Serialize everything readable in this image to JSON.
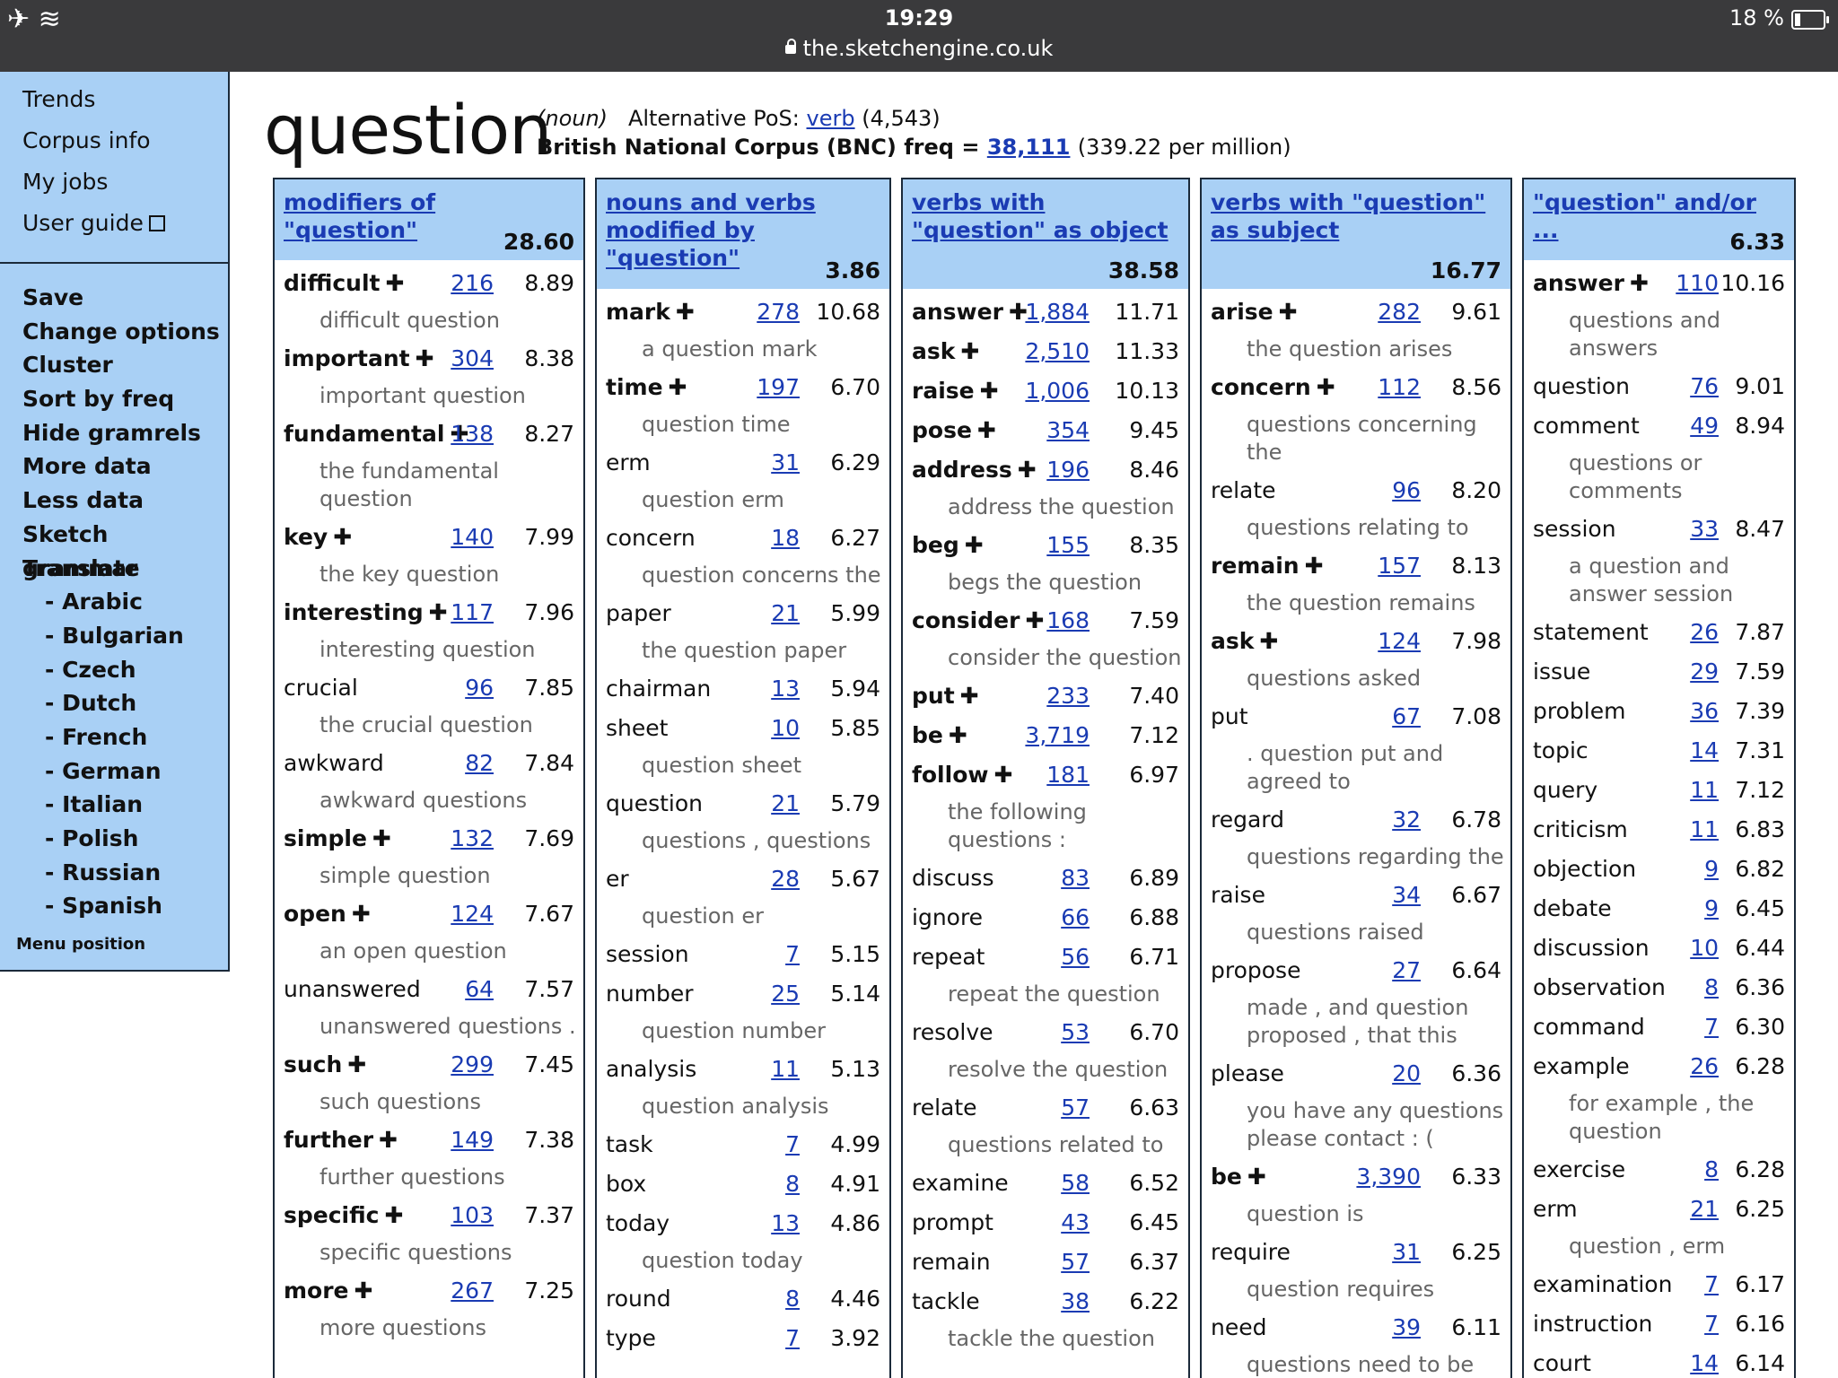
{
  "statusbar": {
    "time": "19:29",
    "url": "the.sketchengine.co.uk",
    "battery": "18 %"
  },
  "sidebar": {
    "top_links": [
      "Trends",
      "Corpus info",
      "My jobs",
      "User guide"
    ],
    "menu": [
      "Save",
      "Change options",
      "Cluster",
      "Sort by freq",
      "Hide gramrels",
      "More data",
      "Less data",
      "Sketch grammar",
      "Translate"
    ],
    "languages": [
      "- Arabic",
      "- Bulgarian",
      "- Czech",
      "- Dutch",
      "- French",
      "- German",
      "- Italian",
      "- Polish",
      "- Russian",
      "- Spanish"
    ],
    "menu_position": "Menu position"
  },
  "header": {
    "word": "question",
    "pos": "(noun)",
    "alt_pos_label": "Alternative PoS:",
    "alt_pos_link": "verb",
    "alt_pos_count": "(4,543)",
    "corpus_label": "British National Corpus (BNC) freq =",
    "freq_link": "38,111",
    "per_million": "(339.22 per million)"
  },
  "columns": [
    {
      "title": "modifiers of \"question\"",
      "score": "28.60",
      "rows": [
        [
          "difficult",
          1,
          "216",
          "8.89",
          "difficult question"
        ],
        [
          "important",
          1,
          "304",
          "8.38",
          "important question"
        ],
        [
          "fundamental",
          1,
          "138",
          "8.27",
          "the fundamental question"
        ],
        [
          "key",
          1,
          "140",
          "7.99",
          "the key question"
        ],
        [
          "interesting",
          1,
          "117",
          "7.96",
          "interesting question"
        ],
        [
          "crucial",
          0,
          "96",
          "7.85",
          "the crucial question"
        ],
        [
          "awkward",
          0,
          "82",
          "7.84",
          "awkward questions"
        ],
        [
          "simple",
          1,
          "132",
          "7.69",
          "simple question"
        ],
        [
          "open",
          1,
          "124",
          "7.67",
          "an open question"
        ],
        [
          "unanswered",
          0,
          "64",
          "7.57",
          "unanswered questions ."
        ],
        [
          "such",
          1,
          "299",
          "7.45",
          "such questions"
        ],
        [
          "further",
          1,
          "149",
          "7.38",
          "further questions"
        ],
        [
          "specific",
          1,
          "103",
          "7.37",
          "specific questions"
        ],
        [
          "more",
          1,
          "267",
          "7.25",
          "more questions"
        ]
      ]
    },
    {
      "title": "nouns and verbs modified by \"question\"",
      "score": "3.86",
      "rows": [
        [
          "mark",
          1,
          "278",
          "10.68",
          "a question mark"
        ],
        [
          "time",
          1,
          "197",
          "6.70",
          "question time"
        ],
        [
          "erm",
          0,
          "31",
          "6.29",
          "question erm"
        ],
        [
          "concern",
          0,
          "18",
          "6.27",
          "question concerns the"
        ],
        [
          "paper",
          0,
          "21",
          "5.99",
          "the question paper"
        ],
        [
          "chairman",
          0,
          "13",
          "5.94",
          ""
        ],
        [
          "sheet",
          0,
          "10",
          "5.85",
          "question sheet"
        ],
        [
          "question",
          0,
          "21",
          "5.79",
          "questions , questions"
        ],
        [
          "er",
          0,
          "28",
          "5.67",
          "question er"
        ],
        [
          "session",
          0,
          "7",
          "5.15",
          ""
        ],
        [
          "number",
          0,
          "25",
          "5.14",
          "question number"
        ],
        [
          "analysis",
          0,
          "11",
          "5.13",
          "question analysis"
        ],
        [
          "task",
          0,
          "7",
          "4.99",
          ""
        ],
        [
          "box",
          0,
          "8",
          "4.91",
          ""
        ],
        [
          "today",
          0,
          "13",
          "4.86",
          "question today"
        ],
        [
          "round",
          0,
          "8",
          "4.46",
          ""
        ],
        [
          "type",
          0,
          "7",
          "3.92",
          ""
        ]
      ]
    },
    {
      "title": "verbs with \"question\" as object",
      "score": "38.58",
      "rows": [
        [
          "answer",
          1,
          "1,884",
          "11.71",
          ""
        ],
        [
          "ask",
          1,
          "2,510",
          "11.33",
          ""
        ],
        [
          "raise",
          1,
          "1,006",
          "10.13",
          ""
        ],
        [
          "pose",
          1,
          "354",
          "9.45",
          ""
        ],
        [
          "address",
          1,
          "196",
          "8.46",
          "address the question"
        ],
        [
          "beg",
          1,
          "155",
          "8.35",
          "begs the question"
        ],
        [
          "consider",
          1,
          "168",
          "7.59",
          "consider the question"
        ],
        [
          "put",
          1,
          "233",
          "7.40",
          ""
        ],
        [
          "be",
          1,
          "3,719",
          "7.12",
          ""
        ],
        [
          "follow",
          1,
          "181",
          "6.97",
          "the following questions :"
        ],
        [
          "discuss",
          0,
          "83",
          "6.89",
          ""
        ],
        [
          "ignore",
          0,
          "66",
          "6.88",
          ""
        ],
        [
          "repeat",
          0,
          "56",
          "6.71",
          "repeat the question"
        ],
        [
          "resolve",
          0,
          "53",
          "6.70",
          "resolve the question"
        ],
        [
          "relate",
          0,
          "57",
          "6.63",
          "questions related to"
        ],
        [
          "examine",
          0,
          "58",
          "6.52",
          ""
        ],
        [
          "prompt",
          0,
          "43",
          "6.45",
          ""
        ],
        [
          "remain",
          0,
          "57",
          "6.37",
          ""
        ],
        [
          "tackle",
          0,
          "38",
          "6.22",
          "tackle the question"
        ]
      ]
    },
    {
      "title": "verbs with \"question\" as subject",
      "score": "16.77",
      "rows": [
        [
          "arise",
          1,
          "282",
          "9.61",
          "the question arises"
        ],
        [
          "concern",
          1,
          "112",
          "8.56",
          "questions concerning the"
        ],
        [
          "relate",
          0,
          "96",
          "8.20",
          "questions relating to"
        ],
        [
          "remain",
          1,
          "157",
          "8.13",
          "the question remains"
        ],
        [
          "ask",
          1,
          "124",
          "7.98",
          "questions asked"
        ],
        [
          "put",
          0,
          "67",
          "7.08",
          ". question put and agreed to"
        ],
        [
          "regard",
          0,
          "32",
          "6.78",
          "questions regarding the"
        ],
        [
          "raise",
          0,
          "34",
          "6.67",
          "questions raised"
        ],
        [
          "propose",
          0,
          "27",
          "6.64",
          "made , and question proposed , that this"
        ],
        [
          "please",
          0,
          "20",
          "6.36",
          "you have any questions please contact : ("
        ],
        [
          "be",
          1,
          "3,390",
          "6.33",
          "question is"
        ],
        [
          "require",
          0,
          "31",
          "6.25",
          "question requires"
        ],
        [
          "need",
          0,
          "39",
          "6.11",
          "questions need to be"
        ]
      ]
    },
    {
      "title": "\"question\" and/or ...",
      "score": "6.33",
      "rows": [
        [
          "answer",
          1,
          "110",
          "10.16",
          "questions and answers"
        ],
        [
          "question",
          0,
          "76",
          "9.01",
          ""
        ],
        [
          "comment",
          0,
          "49",
          "8.94",
          "questions or comments"
        ],
        [
          "session",
          0,
          "33",
          "8.47",
          "a question and answer session"
        ],
        [
          "statement",
          0,
          "26",
          "7.87",
          ""
        ],
        [
          "issue",
          0,
          "29",
          "7.59",
          ""
        ],
        [
          "problem",
          0,
          "36",
          "7.39",
          ""
        ],
        [
          "topic",
          0,
          "14",
          "7.31",
          ""
        ],
        [
          "query",
          0,
          "11",
          "7.12",
          ""
        ],
        [
          "criticism",
          0,
          "11",
          "6.83",
          ""
        ],
        [
          "objection",
          0,
          "9",
          "6.82",
          ""
        ],
        [
          "debate",
          0,
          "9",
          "6.45",
          ""
        ],
        [
          "discussion",
          0,
          "10",
          "6.44",
          ""
        ],
        [
          "observation",
          0,
          "8",
          "6.36",
          ""
        ],
        [
          "command",
          0,
          "7",
          "6.30",
          ""
        ],
        [
          "example",
          0,
          "26",
          "6.28",
          "for example , the question"
        ],
        [
          "exercise",
          0,
          "8",
          "6.28",
          ""
        ],
        [
          "erm",
          0,
          "21",
          "6.25",
          "question , erm"
        ],
        [
          "examination",
          0,
          "7",
          "6.17",
          ""
        ],
        [
          "instruction",
          0,
          "7",
          "6.16",
          ""
        ],
        [
          "court",
          0,
          "14",
          "6.14",
          ""
        ]
      ]
    }
  ]
}
